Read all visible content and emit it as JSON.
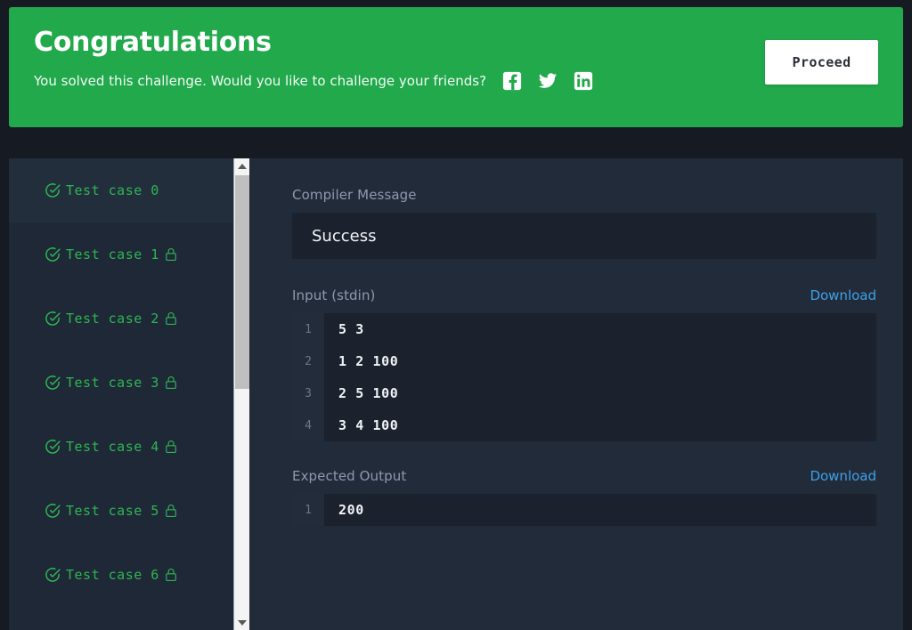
{
  "banner": {
    "title": "Congratulations",
    "subtitle": "You solved this challenge. Would you like to challenge your friends?",
    "proceed_label": "Proceed",
    "background_color": "#22a94c",
    "social": [
      {
        "name": "facebook-icon",
        "label": "Facebook"
      },
      {
        "name": "twitter-icon",
        "label": "Twitter"
      },
      {
        "name": "linkedin-icon",
        "label": "LinkedIn"
      }
    ]
  },
  "sidebar": {
    "test_cases": [
      {
        "label": "Test case 0",
        "status": "passed",
        "locked": false,
        "selected": true
      },
      {
        "label": "Test case 1",
        "status": "passed",
        "locked": true,
        "selected": false
      },
      {
        "label": "Test case 2",
        "status": "passed",
        "locked": true,
        "selected": false
      },
      {
        "label": "Test case 3",
        "status": "passed",
        "locked": true,
        "selected": false
      },
      {
        "label": "Test case 4",
        "status": "passed",
        "locked": true,
        "selected": false
      },
      {
        "label": "Test case 5",
        "status": "passed",
        "locked": true,
        "selected": false
      },
      {
        "label": "Test case 6",
        "status": "passed",
        "locked": true,
        "selected": false
      }
    ],
    "pass_color": "#2eb553"
  },
  "detail": {
    "compiler_message_label": "Compiler Message",
    "compiler_message_value": "Success",
    "input_label": "Input (stdin)",
    "input_download_label": "Download",
    "input_lines": [
      {
        "n": "1",
        "text": "5 3"
      },
      {
        "n": "2",
        "text": "1 2 100"
      },
      {
        "n": "3",
        "text": "2 5 100"
      },
      {
        "n": "4",
        "text": "3 4 100"
      }
    ],
    "expected_label": "Expected Output",
    "expected_download_label": "Download",
    "expected_lines": [
      {
        "n": "1",
        "text": "200"
      }
    ],
    "link_color": "#3da2ea"
  }
}
